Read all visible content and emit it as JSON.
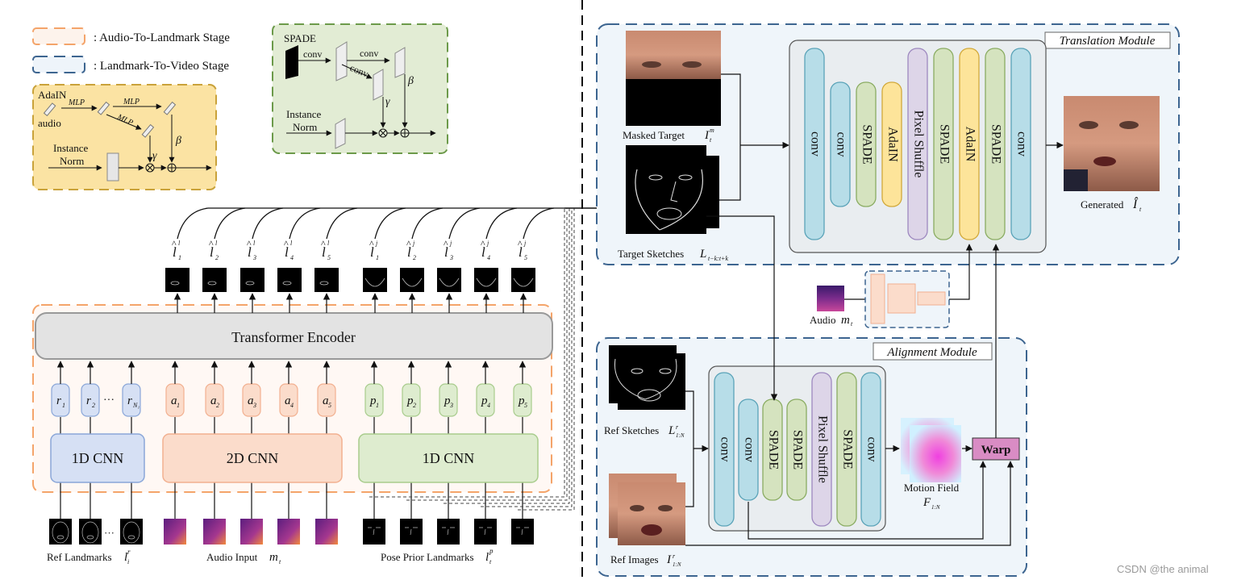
{
  "legend": {
    "audio_to_landmark": ": Audio-To-Landmark Stage",
    "landmark_to_video": ": Landmark-To-Video Stage"
  },
  "colors": {
    "orange_stage": "#f4a46a",
    "blue_stage": "#3d6590",
    "adain_box_fill": "#fbe3a3",
    "adain_box_border": "#c9a23a",
    "spade_box_fill": "#e2ecd4",
    "spade_box_border": "#6c9a4a",
    "conv": "#b7dde8",
    "spade": "#d5e3bf",
    "adain": "#fde49a",
    "pixel_shuffle": "#ddd5e8",
    "warp": "#d98cc4",
    "transformer": "#e3e3e3",
    "r_token": "#d6e0f4",
    "a_token": "#fbdccb",
    "p_token": "#deeccf"
  },
  "adain_block": {
    "title": "AdaIN",
    "input": "audio",
    "mlp": "MLP",
    "gamma": "γ",
    "beta": "β",
    "norm_line1": "Instance",
    "norm_line2": "Norm"
  },
  "spade_block": {
    "title": "SPADE",
    "conv": "conv",
    "gamma": "γ",
    "beta": "β",
    "norm_line1": "Instance",
    "norm_line2": "Norm"
  },
  "audio_to_landmark": {
    "transformer_label": "Transformer Encoder",
    "output_tokens_l": [
      "1",
      "2",
      "3",
      "4",
      "5"
    ],
    "output_tokens_j": [
      "1",
      "2",
      "3",
      "4",
      "5"
    ],
    "output_sup_l": "l",
    "output_sup_j": "j",
    "r_tokens": [
      "r",
      "r",
      "r"
    ],
    "r_subs": [
      "1",
      "2",
      "N₁"
    ],
    "r_ellipsis": "···",
    "a_tokens": [
      "a",
      "a",
      "a",
      "a",
      "a"
    ],
    "a_subs": [
      "1",
      "2",
      "3",
      "4",
      "5"
    ],
    "p_tokens": [
      "p",
      "p",
      "p",
      "p",
      "p"
    ],
    "p_subs": [
      "1",
      "2",
      "3",
      "4",
      "5"
    ],
    "cnn_ref": "1D CNN",
    "cnn_audio": "2D CNN",
    "cnn_pose": "1D CNN",
    "input_ref_label": "Ref Landmarks",
    "input_ref_sym": "l",
    "input_ref_sup": "r",
    "input_ref_sub": "i",
    "input_audio_label": "Audio Input",
    "input_audio_sym": "m",
    "input_audio_sub": "t",
    "input_pose_label": "Pose Prior Landmarks",
    "input_pose_sym": "l",
    "input_pose_sup": "p",
    "input_pose_sub": "t"
  },
  "translation_module": {
    "title": "Translation Module",
    "masked_target_label": "Masked Target",
    "masked_target_sym": "I",
    "masked_target_sup": "m",
    "masked_target_sub": "t",
    "target_sketches_label": "Target Sketches",
    "target_sketches_sym": "L",
    "target_sketches_sub": "t−k:t+k",
    "layers": [
      "conv",
      "conv",
      "SPADE",
      "AdaIN",
      "Pixel Shuffle",
      "SPADE",
      "AdaIN",
      "SPADE",
      "conv"
    ],
    "generated_label": "Generated",
    "generated_sym": "Î",
    "generated_sub": "t",
    "audio_label": "Audio",
    "audio_sym": "m",
    "audio_sub": "t"
  },
  "alignment_module": {
    "title": "Alignment Module",
    "ref_sketches_label": "Ref Sketches",
    "ref_sketches_sym": "L",
    "ref_sketches_sup": "r",
    "ref_sketches_sub": "1:N",
    "ref_images_label": "Ref Images",
    "ref_images_sym": "I",
    "ref_images_sup": "r",
    "ref_images_sub": "1:N",
    "layers": [
      "conv",
      "conv",
      "SPADE",
      "SPADE",
      "Pixel Shuffle",
      "SPADE",
      "conv"
    ],
    "motion_field_label": "Motion Field",
    "motion_field_sym": "F",
    "motion_field_sub": "1:N",
    "warp_label": "Warp"
  },
  "watermark": "CSDN @the animal"
}
